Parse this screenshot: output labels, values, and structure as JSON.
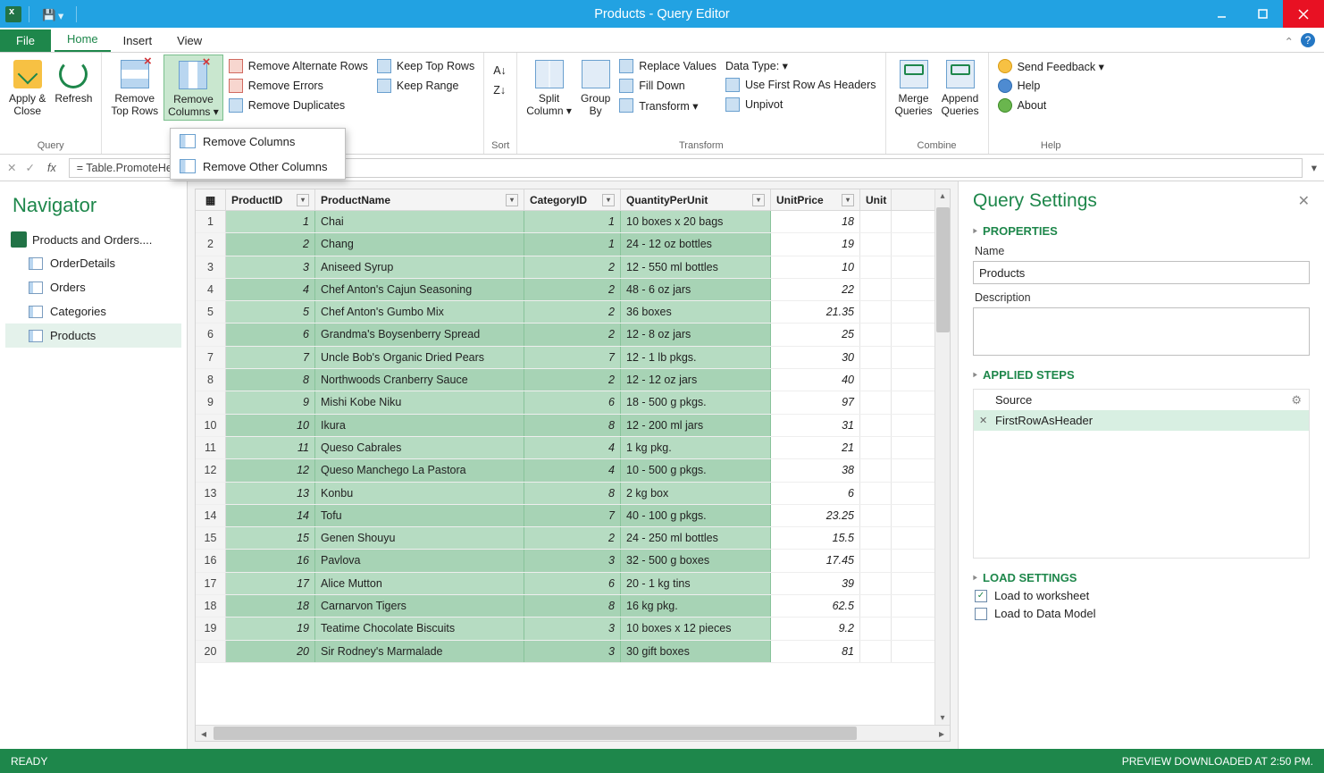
{
  "window": {
    "title": "Products - Query Editor"
  },
  "tabs": {
    "file": "File",
    "home": "Home",
    "insert": "Insert",
    "view": "View"
  },
  "ribbon": {
    "groups": {
      "query": "Query",
      "sort": "Sort",
      "transform": "Transform",
      "combine": "Combine",
      "help": "Help"
    },
    "apply_close": "Apply &\nClose",
    "refresh": "Refresh",
    "remove_top_rows": "Remove\nTop Rows",
    "remove_columns": "Remove\nColumns ▾",
    "remove_alt_rows": "Remove Alternate Rows",
    "remove_errors": "Remove Errors",
    "remove_duplicates": "Remove Duplicates",
    "keep_top_rows": "Keep Top Rows",
    "keep_range": "Keep Range",
    "sort_asc": "A↓Z",
    "sort_desc": "Z↓A",
    "split_column": "Split\nColumn ▾",
    "group_by": "Group\nBy",
    "replace_values": "Replace Values",
    "fill_down": "Fill Down",
    "transform": "Transform ▾",
    "data_type": "Data Type:  ▾",
    "use_first_row": "Use First Row As Headers",
    "unpivot": "Unpivot",
    "merge_queries": "Merge\nQueries",
    "append_queries": "Append\nQueries",
    "send_feedback": "Send Feedback ▾",
    "help": "Help",
    "about": "About"
  },
  "dropdown": {
    "remove_columns": "Remove Columns",
    "remove_other_columns": "Remove Other Columns"
  },
  "formula": "= Table.PromoteHeaders(Products)",
  "nav": {
    "title": "Navigator",
    "root": "Products and Orders....",
    "items": [
      "OrderDetails",
      "Orders",
      "Categories",
      "Products"
    ],
    "selected": "Products"
  },
  "columns": [
    "ProductID",
    "ProductName",
    "CategoryID",
    "QuantityPerUnit",
    "UnitPrice",
    "Unit"
  ],
  "rows": [
    {
      "n": 1,
      "id": "1",
      "name": "Chai",
      "cat": "1",
      "qty": "10 boxes x 20 bags",
      "price": "18"
    },
    {
      "n": 2,
      "id": "2",
      "name": "Chang",
      "cat": "1",
      "qty": "24 - 12 oz bottles",
      "price": "19"
    },
    {
      "n": 3,
      "id": "3",
      "name": "Aniseed Syrup",
      "cat": "2",
      "qty": "12 - 550 ml bottles",
      "price": "10"
    },
    {
      "n": 4,
      "id": "4",
      "name": "Chef Anton's Cajun Seasoning",
      "cat": "2",
      "qty": "48 - 6 oz jars",
      "price": "22"
    },
    {
      "n": 5,
      "id": "5",
      "name": "Chef Anton's Gumbo Mix",
      "cat": "2",
      "qty": "36 boxes",
      "price": "21.35"
    },
    {
      "n": 6,
      "id": "6",
      "name": "Grandma's Boysenberry Spread",
      "cat": "2",
      "qty": "12 - 8 oz jars",
      "price": "25"
    },
    {
      "n": 7,
      "id": "7",
      "name": "Uncle Bob's Organic Dried Pears",
      "cat": "7",
      "qty": "12 - 1 lb pkgs.",
      "price": "30"
    },
    {
      "n": 8,
      "id": "8",
      "name": "Northwoods Cranberry Sauce",
      "cat": "2",
      "qty": "12 - 12 oz jars",
      "price": "40"
    },
    {
      "n": 9,
      "id": "9",
      "name": "Mishi Kobe Niku",
      "cat": "6",
      "qty": "18 - 500 g pkgs.",
      "price": "97"
    },
    {
      "n": 10,
      "id": "10",
      "name": "Ikura",
      "cat": "8",
      "qty": "12 - 200 ml jars",
      "price": "31"
    },
    {
      "n": 11,
      "id": "11",
      "name": "Queso Cabrales",
      "cat": "4",
      "qty": "1 kg pkg.",
      "price": "21"
    },
    {
      "n": 12,
      "id": "12",
      "name": "Queso Manchego La Pastora",
      "cat": "4",
      "qty": "10 - 500 g pkgs.",
      "price": "38"
    },
    {
      "n": 13,
      "id": "13",
      "name": "Konbu",
      "cat": "8",
      "qty": "2 kg box",
      "price": "6"
    },
    {
      "n": 14,
      "id": "14",
      "name": "Tofu",
      "cat": "7",
      "qty": "40 - 100 g pkgs.",
      "price": "23.25"
    },
    {
      "n": 15,
      "id": "15",
      "name": "Genen Shouyu",
      "cat": "2",
      "qty": "24 - 250 ml bottles",
      "price": "15.5"
    },
    {
      "n": 16,
      "id": "16",
      "name": "Pavlova",
      "cat": "3",
      "qty": "32 - 500 g boxes",
      "price": "17.45"
    },
    {
      "n": 17,
      "id": "17",
      "name": "Alice Mutton",
      "cat": "6",
      "qty": "20 - 1 kg tins",
      "price": "39"
    },
    {
      "n": 18,
      "id": "18",
      "name": "Carnarvon Tigers",
      "cat": "8",
      "qty": "16 kg pkg.",
      "price": "62.5"
    },
    {
      "n": 19,
      "id": "19",
      "name": "Teatime Chocolate Biscuits",
      "cat": "3",
      "qty": "10 boxes x 12 pieces",
      "price": "9.2"
    },
    {
      "n": 20,
      "id": "20",
      "name": "Sir Rodney's Marmalade",
      "cat": "3",
      "qty": "30 gift boxes",
      "price": "81"
    }
  ],
  "settings": {
    "title": "Query Settings",
    "properties": "PROPERTIES",
    "name_label": "Name",
    "name_value": "Products",
    "desc_label": "Description",
    "applied_steps": "APPLIED STEPS",
    "steps": [
      "Source",
      "FirstRowAsHeader"
    ],
    "load_settings": "LOAD SETTINGS",
    "load_worksheet": "Load to worksheet",
    "load_model": "Load to Data Model"
  },
  "status": {
    "ready": "READY",
    "right": "PREVIEW DOWNLOADED AT 2:50 PM."
  }
}
